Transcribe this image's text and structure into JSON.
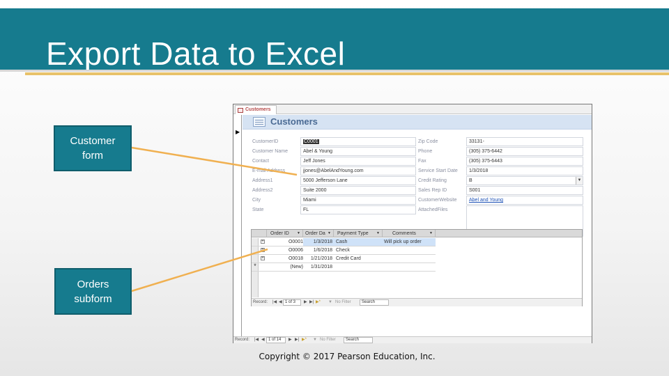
{
  "slide": {
    "title": "Export Data to Excel",
    "copyright": "Copyright © 2017 Pearson Education, Inc.",
    "accent_color": "#167b8e",
    "gold_color": "#e8c26a"
  },
  "callouts": {
    "customer_form": "Customer form",
    "orders_subform": "Orders subform"
  },
  "access": {
    "tab_label": "Customers",
    "form_title": "Customers",
    "fields_left": [
      {
        "label": "CustomerID",
        "value": "C0001"
      },
      {
        "label": "Customer Name",
        "value": "Abel & Young"
      },
      {
        "label": "Contact",
        "value": "Jeff Jones"
      },
      {
        "label": "E-mail Address",
        "value": "jjones@AbelAndYoung.com"
      },
      {
        "label": "Address1",
        "value": "5000 Jefferson Lane"
      },
      {
        "label": "Address2",
        "value": "Suite 2000"
      },
      {
        "label": "City",
        "value": "Miami"
      },
      {
        "label": "State",
        "value": "FL"
      }
    ],
    "fields_right": [
      {
        "label": "Zip Code",
        "value": "33131-"
      },
      {
        "label": "Phone",
        "value": "(305) 375-6442"
      },
      {
        "label": "Fax",
        "value": "(305) 375-6443"
      },
      {
        "label": "Service Start Date",
        "value": "1/3/2018"
      },
      {
        "label": "Credit Rating",
        "value": "B"
      },
      {
        "label": "Sales Rep ID",
        "value": "S001"
      },
      {
        "label": "CustomerWebsite",
        "value": "Abel and Young"
      },
      {
        "label": "AttachedFiles",
        "value": ""
      }
    ],
    "subform": {
      "columns": [
        "Order ID",
        "Order Da",
        "Payment Type",
        "Comments"
      ],
      "rows": [
        {
          "id": "O0001",
          "date": "1/3/2018",
          "payment": "Cash",
          "comments": "Will pick up order"
        },
        {
          "id": "O0006",
          "date": "1/6/2018",
          "payment": "Check",
          "comments": ""
        },
        {
          "id": "O0018",
          "date": "1/21/2018",
          "payment": "Credit Card",
          "comments": ""
        },
        {
          "id": "(New)",
          "date": "1/31/2018",
          "payment": "",
          "comments": ""
        }
      ],
      "nav": {
        "record_label": "Record:",
        "position": "1 of 3",
        "filter": "No Filter",
        "search": "Search"
      }
    },
    "main_nav": {
      "record_label": "Record:",
      "position": "1 of 14",
      "filter": "No Filter",
      "search": "Search"
    }
  }
}
